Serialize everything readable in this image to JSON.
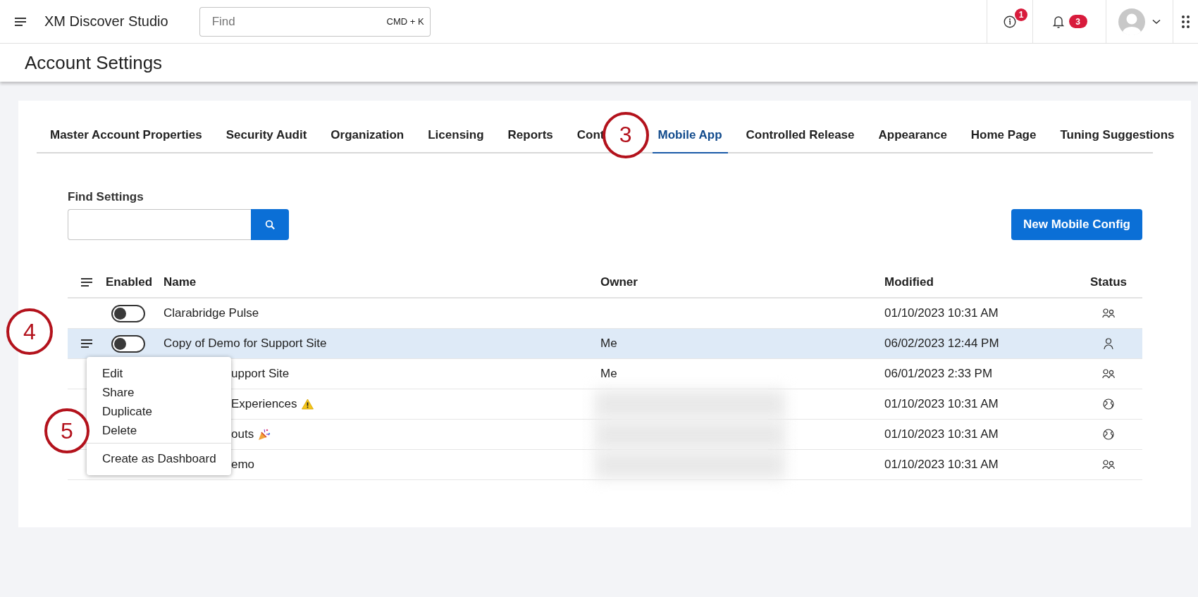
{
  "topbar": {
    "app_title": "XM Discover Studio",
    "search": {
      "placeholder": "Find",
      "shortcut": "CMD + K"
    },
    "info_badge": "1",
    "notification_badge": "3"
  },
  "page_title": "Account Settings",
  "tabs": [
    {
      "label": "Master Account Properties",
      "selected": false
    },
    {
      "label": "Security Audit",
      "selected": false
    },
    {
      "label": "Organization",
      "selected": false
    },
    {
      "label": "Licensing",
      "selected": false
    },
    {
      "label": "Reports",
      "selected": false
    },
    {
      "label": "Cont",
      "selected": false
    },
    {
      "label": "Mobile App",
      "selected": true,
      "step_marker": "3"
    },
    {
      "label": "Controlled Release",
      "selected": false
    },
    {
      "label": "Appearance",
      "selected": false
    },
    {
      "label": "Home Page",
      "selected": false
    },
    {
      "label": "Tuning Suggestions",
      "selected": false
    }
  ],
  "find_settings": {
    "label": "Find Settings"
  },
  "new_button": "New Mobile Config",
  "table": {
    "columns": [
      "Enabled",
      "Name",
      "Owner",
      "Modified",
      "Status"
    ],
    "rows": [
      {
        "selected": false,
        "covered": false,
        "enabled": false,
        "name": "Clarabridge Pulse",
        "owner_redacted": false,
        "modified": "01/10/2023 10:31 AM",
        "status": {
          "kind": "shared"
        }
      },
      {
        "selected": true,
        "covered": false,
        "enabled": false,
        "name": "Copy of Demo for Support Site",
        "owner": "Me",
        "owner_redacted": false,
        "modified": "06/02/2023 12:44 PM",
        "status": {
          "kind": "private"
        },
        "step_marker": "4"
      },
      {
        "selected": false,
        "covered": true,
        "name": "upport Site",
        "owner": "Me",
        "owner_redacted": false,
        "modified": "06/01/2023 2:33 PM",
        "status": {
          "kind": "shared"
        }
      },
      {
        "selected": false,
        "covered": true,
        "name": "Experiences",
        "name_icon": {
          "kind": "warning"
        },
        "owner_redacted": true,
        "modified": "01/10/2023 10:31 AM",
        "status": {
          "kind": "public"
        }
      },
      {
        "selected": false,
        "covered": true,
        "name": "outs",
        "name_icon": {
          "kind": "party"
        },
        "owner_redacted": true,
        "modified": "01/10/2023 10:31 AM",
        "status": {
          "kind": "public"
        }
      },
      {
        "selected": false,
        "covered": true,
        "name": "emo",
        "owner_redacted": true,
        "modified": "01/10/2023 10:31 AM",
        "status": {
          "kind": "shared"
        }
      }
    ]
  },
  "context_menu": {
    "groups": [
      [
        {
          "label": "Edit"
        },
        {
          "label": "Share"
        },
        {
          "label": "Duplicate"
        },
        {
          "label": "Delete",
          "step_marker": "5"
        }
      ],
      [
        {
          "label": "Create as Dashboard"
        }
      ]
    ]
  }
}
